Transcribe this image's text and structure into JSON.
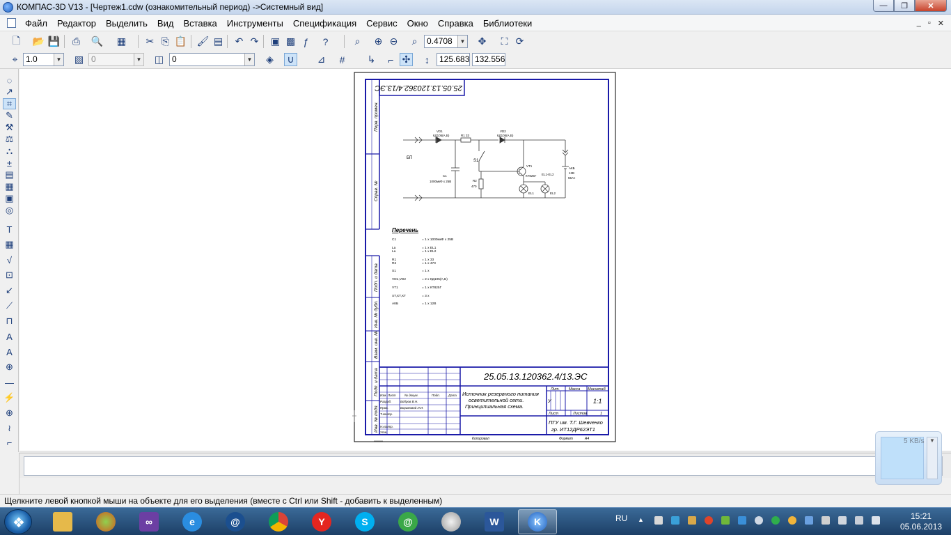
{
  "window": {
    "title": "КОМПАС-3D V13 - [Чертеж1.cdw (ознакомительный период) ->Системный вид]",
    "minimize": "—",
    "restore": "❐",
    "close": "✕"
  },
  "menu": {
    "items": [
      "Файл",
      "Редактор",
      "Выделить",
      "Вид",
      "Вставка",
      "Инструменты",
      "Спецификация",
      "Сервис",
      "Окно",
      "Справка",
      "Библиотеки"
    ],
    "mdi_buttons": [
      "_",
      "▫",
      "✕"
    ]
  },
  "toolbar1": {
    "zoom_value": "0.4708"
  },
  "toolbar2": {
    "step_value": "1.0",
    "layer_value": "0",
    "style_value": "0",
    "coord_x": "125.683",
    "coord_y": "132.556"
  },
  "drawing": {
    "stamp_rotated": "25.05.13.120362.4/13.ЭС",
    "designation": "25.05.13.120362.4/13.ЭС",
    "title": "Источник резервного питания осветительной сети. Принципиальная схема.",
    "title_lines": [
      "Источник резервного питания",
      "осветительной сети.",
      "Принципиальная схема."
    ],
    "col_lit": "Лит.",
    "col_mass": "Масса",
    "col_scale": "Масштаб",
    "scale_value": "1:1",
    "lit_value": "У",
    "sheet_label": "Лист",
    "sheets_label": "Листов",
    "sheets_value": "1",
    "org_lines": [
      "ПГУ им. Т.Г. Шевченко",
      "гр. ИТ12ДР62ЭТ1"
    ],
    "role_rows": [
      "Изм.",
      "Лист",
      "№ докум.",
      "Подп.",
      "Дата"
    ],
    "people": [
      {
        "role": "Разраб.",
        "name": "Бобров В.Н."
      },
      {
        "role": "Пров.",
        "name": "Боримовой Л.И."
      },
      {
        "role": "Т.контр.",
        "name": ""
      },
      {
        "role": "Н.контр.",
        "name": ""
      },
      {
        "role": "Утв.",
        "name": ""
      }
    ],
    "copied_label": "Копировал",
    "format_label": "Формат",
    "format_value": "А4",
    "side_labels": [
      "Перв. примен.",
      "Справ. №",
      "Подп. и дата",
      "Инв. № дубл.",
      "Взам. инв. №",
      "Подп. и дата",
      "Инв. № подл."
    ]
  },
  "schematic": {
    "labels": {
      "vd1": "VD1",
      "vd1_part": "КД105(А,Б)",
      "r1": "R1 33",
      "vd2": "VD2",
      "vd2_part": "КД105(А,Б)",
      "s1": "S1",
      "bp": "БП",
      "c1": "C1",
      "c1_value": "1000мкФ x 25В",
      "r2": "R2",
      "r2_value": "470",
      "vt1": "VT1",
      "vt1_part": "КТ825Г",
      "el_label": "EL1-EL2",
      "akb": "АКБ",
      "akb_v": "12В",
      "akb_cap": "55Ач",
      "el1": "EL1",
      "el2": "EL2"
    }
  },
  "parts_list": {
    "title": "Перечень",
    "rows": [
      {
        "ref": "C1",
        "desc": "= 1 x 1000мкФ x 25В"
      },
      {
        "ref": "La",
        "desc": "= 1 x EL1"
      },
      {
        "ref": "La",
        "desc": "= 1 x EL2"
      },
      {
        "ref": "R1",
        "desc": "= 1 x 33"
      },
      {
        "ref": "R2",
        "desc": "= 1 x 470"
      },
      {
        "ref": "S1",
        "desc": "= 1 x"
      },
      {
        "ref": "VD1,VD2",
        "desc": "= 2 x КД105(А,Б)"
      },
      {
        "ref": "VT1",
        "desc": "= 1 x КТ825Г"
      },
      {
        "ref": "XT,XT,XT",
        "desc": "= 3 x"
      },
      {
        "ref": "АКБ",
        "desc": "= 1 x 12В"
      }
    ]
  },
  "status": {
    "text": "Щелкните левой кнопкой мыши на объекте для его выделения (вместе с Ctrl или Shift - добавить к выделенным)"
  },
  "network_widget": {
    "speed": "5 KB/s"
  },
  "taskbar": {
    "lang": "RU",
    "time": "15:21",
    "date": "05.06.2013",
    "apps": [
      "explorer",
      "media",
      "visual-studio",
      "internet-explorer",
      "mail-agent",
      "chrome",
      "yandex-browser",
      "skype",
      "icq",
      "clock-app",
      "word",
      "kompas"
    ]
  },
  "colors": {
    "frame": "#1a1aa8",
    "titlebar": "#c4d5ec",
    "taskbar": "#1c3f66"
  }
}
